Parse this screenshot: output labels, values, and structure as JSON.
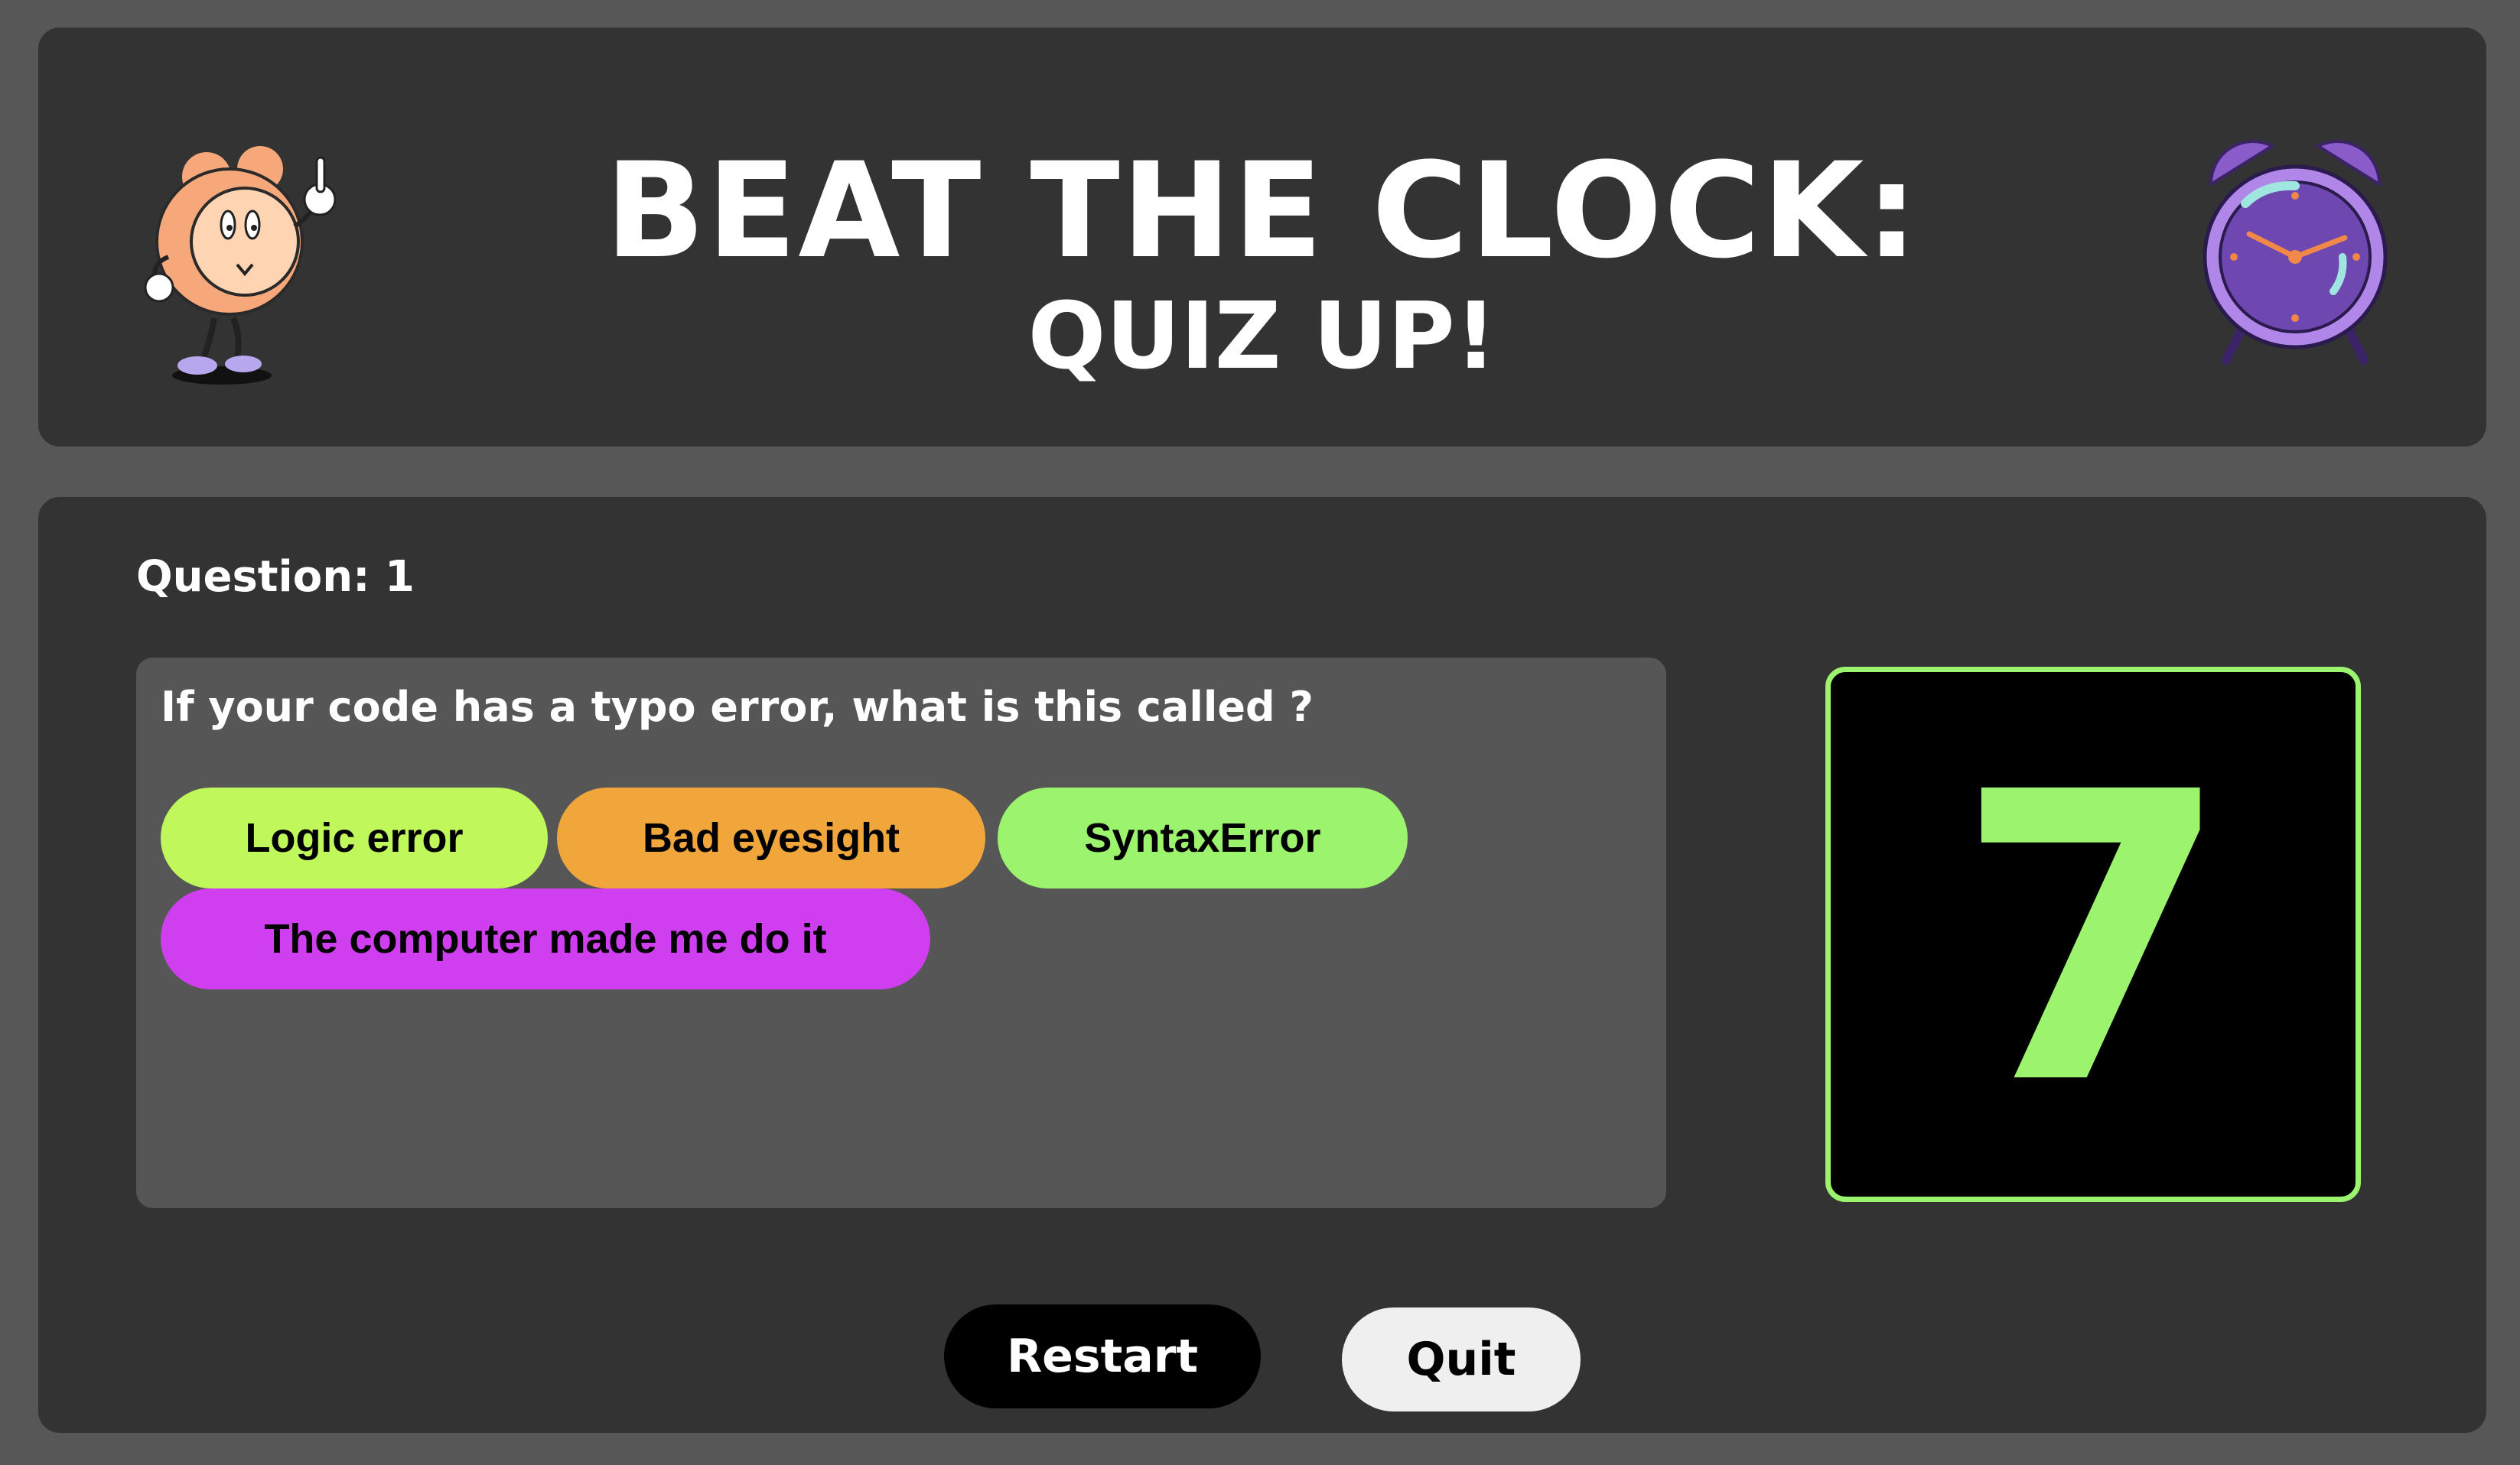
{
  "header": {
    "title_line1": "BEAT THE CLOCK:",
    "title_line2": "QUIZ UP!"
  },
  "quiz": {
    "question_number_label": "Question: 1",
    "question_text": "If your code has a typo error, what is this called ?",
    "answers": [
      {
        "label": "Logic error",
        "color": "#c0f75a"
      },
      {
        "label": "Bad eyesight",
        "color": "#f0a63b"
      },
      {
        "label": "SyntaxError",
        "color": "#9cf36e"
      },
      {
        "label": "The computer made me do it",
        "color": "#cf3ff0"
      }
    ]
  },
  "timer": {
    "seconds_left": "7",
    "color": "#9cf36e"
  },
  "controls": {
    "restart_label": "Restart",
    "quit_label": "Quit"
  },
  "icons": {
    "left": "clock-mascot-icon",
    "right": "alarm-clock-icon"
  }
}
